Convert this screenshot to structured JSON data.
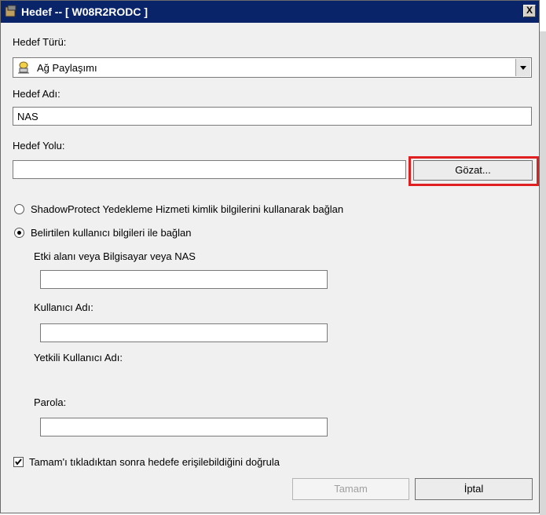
{
  "window": {
    "title": "Hedef -- [ W08R2RODC ]",
    "close_label": "X"
  },
  "target_type": {
    "label": "Hedef Türü:",
    "selected": "Ağ Paylaşımı"
  },
  "target_name": {
    "label": "Hedef Adı:",
    "value": "NAS"
  },
  "target_path": {
    "label": "Hedef Yolu:",
    "value": "",
    "browse_label": "Gözat..."
  },
  "auth": {
    "option1": "ShadowProtect Yedekleme Hizmeti kimlik bilgilerini kullanarak bağlan",
    "option2": "Belirtilen kullanıcı bilgileri ile bağlan",
    "selected": "option2"
  },
  "credentials": {
    "domain_label": "Etki alanı veya Bilgisayar veya NAS",
    "domain_value": "",
    "user_label": "Kullanıcı Adı:",
    "user_value": "",
    "admin_label": "Yetkili Kullanıcı Adı:",
    "password_label": "Parola:",
    "password_value": ""
  },
  "verify": {
    "label": "Tamam'ı tıkladıktan sonra hedefe erişilebildiğini doğrula",
    "checked": true
  },
  "buttons": {
    "ok": "Tamam",
    "cancel": "İptal"
  }
}
